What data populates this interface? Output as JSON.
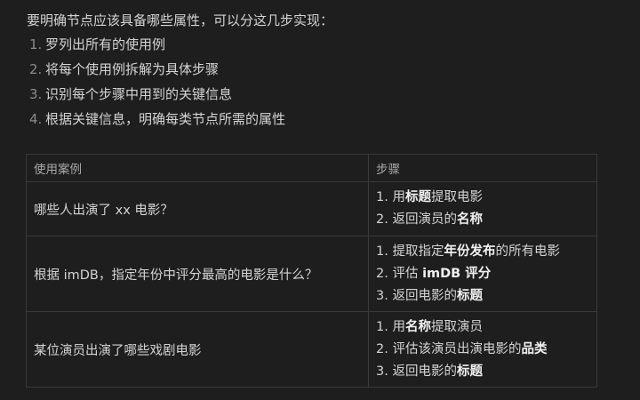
{
  "intro": "要明确节点应该具备哪些属性，可以分这几步实现：",
  "steps": [
    {
      "num": "1.",
      "text": "罗列出所有的使用例"
    },
    {
      "num": "2.",
      "text": "将每个使用例拆解为具体步骤"
    },
    {
      "num": "3.",
      "text": "识别每个步骤中用到的关键信息"
    },
    {
      "num": "4.",
      "text": "根据关键信息，明确每类节点所需的属性"
    }
  ],
  "table": {
    "headers": [
      "使用案例",
      "步骤"
    ],
    "rows": [
      {
        "case": "哪些人出演了 xx 电影？",
        "steps": [
          {
            "num": "1.",
            "pre": "用",
            "bold": "标题",
            "post": "提取电影"
          },
          {
            "num": "2.",
            "pre": "返回演员的",
            "bold": "名称",
            "post": ""
          }
        ]
      },
      {
        "case": "根据 imDB，指定年份中评分最高的电影是什么？",
        "steps": [
          {
            "num": "1.",
            "pre": "提取指定",
            "bold": "年份发布",
            "post": "的所有电影"
          },
          {
            "num": "2.",
            "pre": "评估 ",
            "bold": "imDB 评分",
            "post": ""
          },
          {
            "num": "3.",
            "pre": "返回电影的",
            "bold": "标题",
            "post": ""
          }
        ]
      },
      {
        "case": "某位演员出演了哪些戏剧电影",
        "steps": [
          {
            "num": "1.",
            "pre": "用",
            "bold": "名称",
            "post": "提取演员"
          },
          {
            "num": "2.",
            "pre": "评估该演员出演电影的",
            "bold": "品类",
            "post": ""
          },
          {
            "num": "3.",
            "pre": "返回电影的",
            "bold": "标题",
            "post": ""
          }
        ]
      }
    ]
  }
}
